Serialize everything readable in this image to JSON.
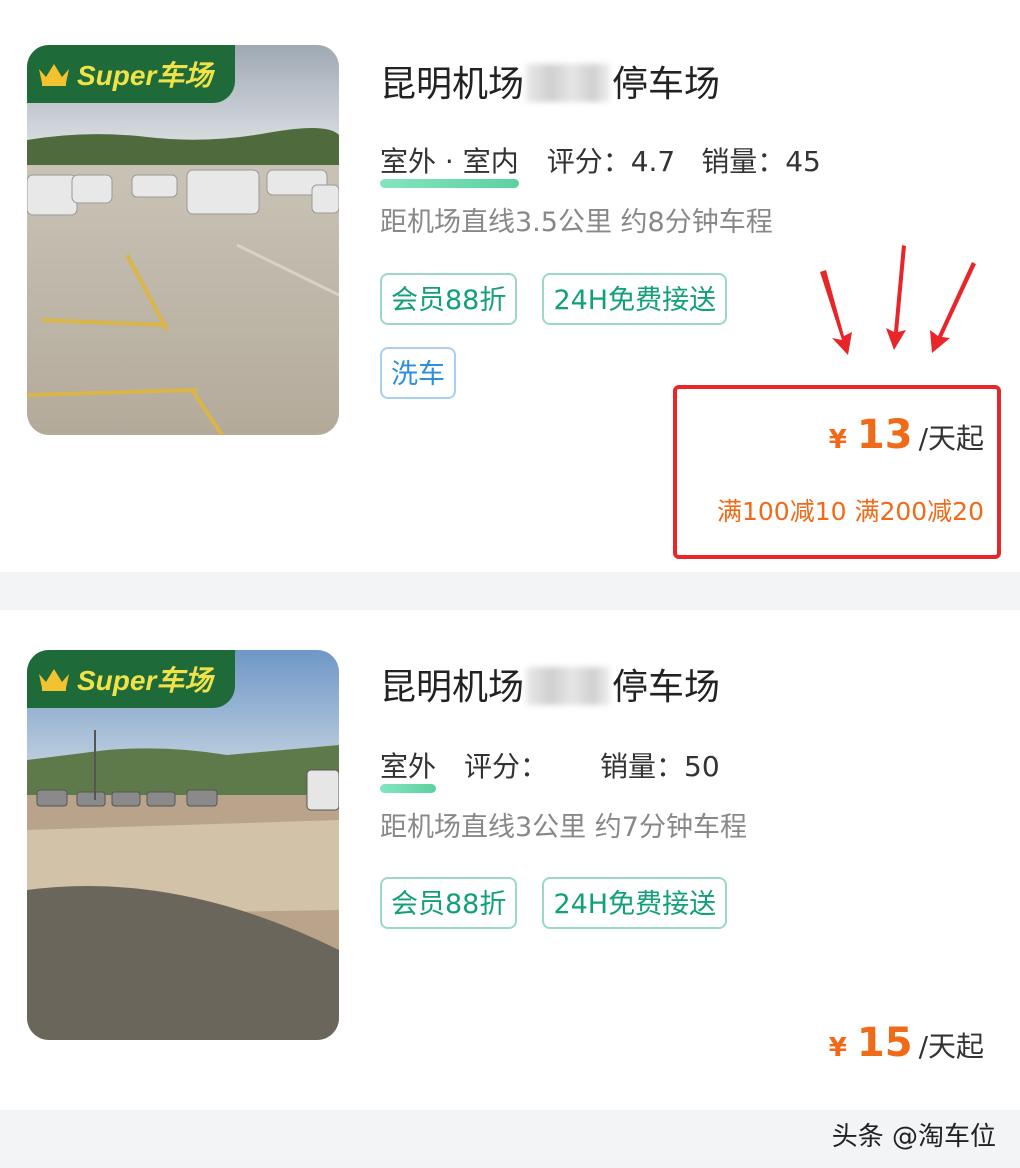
{
  "listings": [
    {
      "badge": "Super车场",
      "title_prefix": "昆明机场",
      "title_suffix": "停车场",
      "env": "室外 · 室内",
      "rating": "评分：4.7",
      "sales": "销量：45",
      "distance": "距机场直线3.5公里 约8分钟车程",
      "tags": [
        "会员88折",
        "24H免费接送",
        "洗车"
      ],
      "currency": "¥",
      "price": "13",
      "unit": "/天起",
      "discount": "满100减10  满200减20"
    },
    {
      "badge": "Super车场",
      "title_prefix": "昆明机场",
      "title_suffix": "停车场",
      "env": "室外",
      "rating": "评分：",
      "sales": "销量：50",
      "distance": "距机场直线3公里 约7分钟车程",
      "tags": [
        "会员88折",
        "24H免费接送"
      ],
      "currency": "¥",
      "price": "15",
      "unit": "/天起"
    }
  ],
  "watermark": "头条 @淘车位",
  "colors": {
    "accent_orange": "#f06a18",
    "highlight_red": "#e8262a",
    "badge_green": "#1e6a38",
    "tag_green": "#12a07a",
    "tag_blue": "#2f8fdb"
  }
}
